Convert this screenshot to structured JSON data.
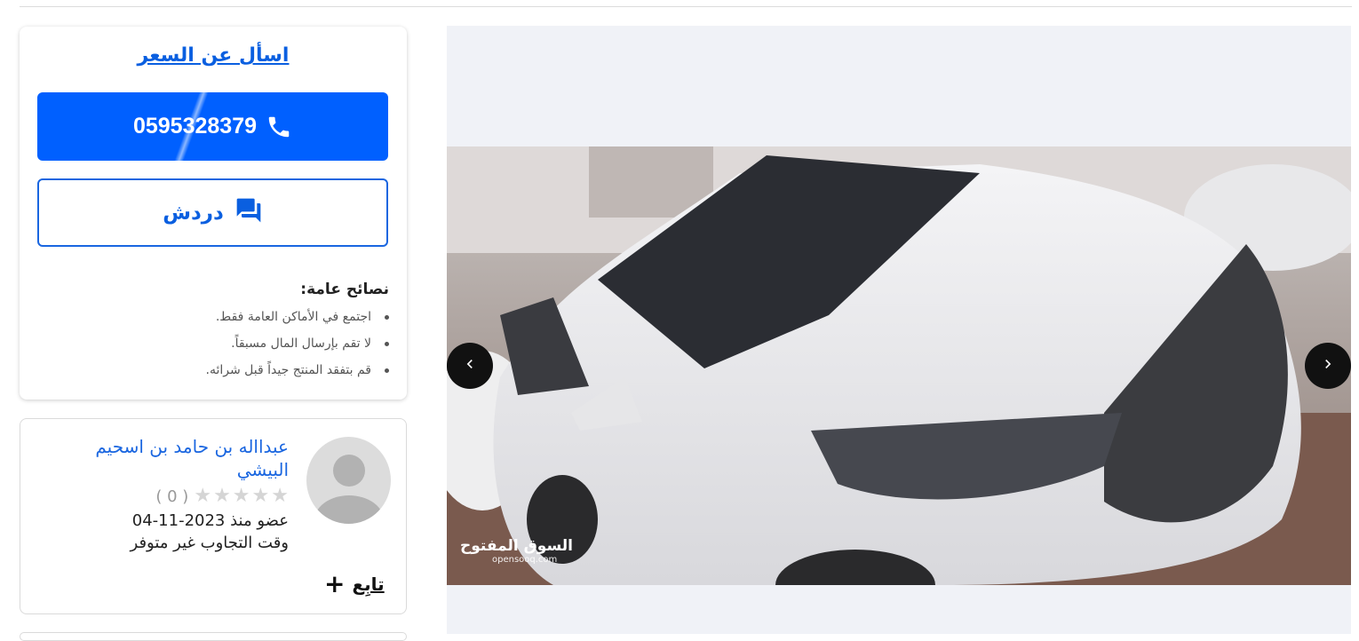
{
  "sidebar": {
    "ask_price": "اسأل عن السعر",
    "phone_number": "0595328379",
    "chat_label": "دردش",
    "tips": {
      "title": "نصائح عامة:",
      "items": [
        "اجتمع في الأماكن العامة فقط.",
        "لا تقم بإرسال المال مسبقاً.",
        "قم بتفقد المنتج جيداً قبل شرائه."
      ]
    }
  },
  "seller": {
    "name": "عبدااله بن حامد بن اسحيم البيشي",
    "rating_count": "( 0 )",
    "rating": 0,
    "member_since": "عضو منذ 2023-11-04",
    "response_time": "وقت التجاوب غير متوفر",
    "follow_label": "تابِع"
  },
  "gallery": {
    "watermark_ar": "السوق المفتوح",
    "watermark_en": "opensooq.com",
    "icons": [
      "chevron-left-icon",
      "chevron-right-icon"
    ]
  },
  "colors": {
    "primary": "#0060ff",
    "link": "#0a5fe0",
    "gallery_bg": "#f0f2f7"
  }
}
